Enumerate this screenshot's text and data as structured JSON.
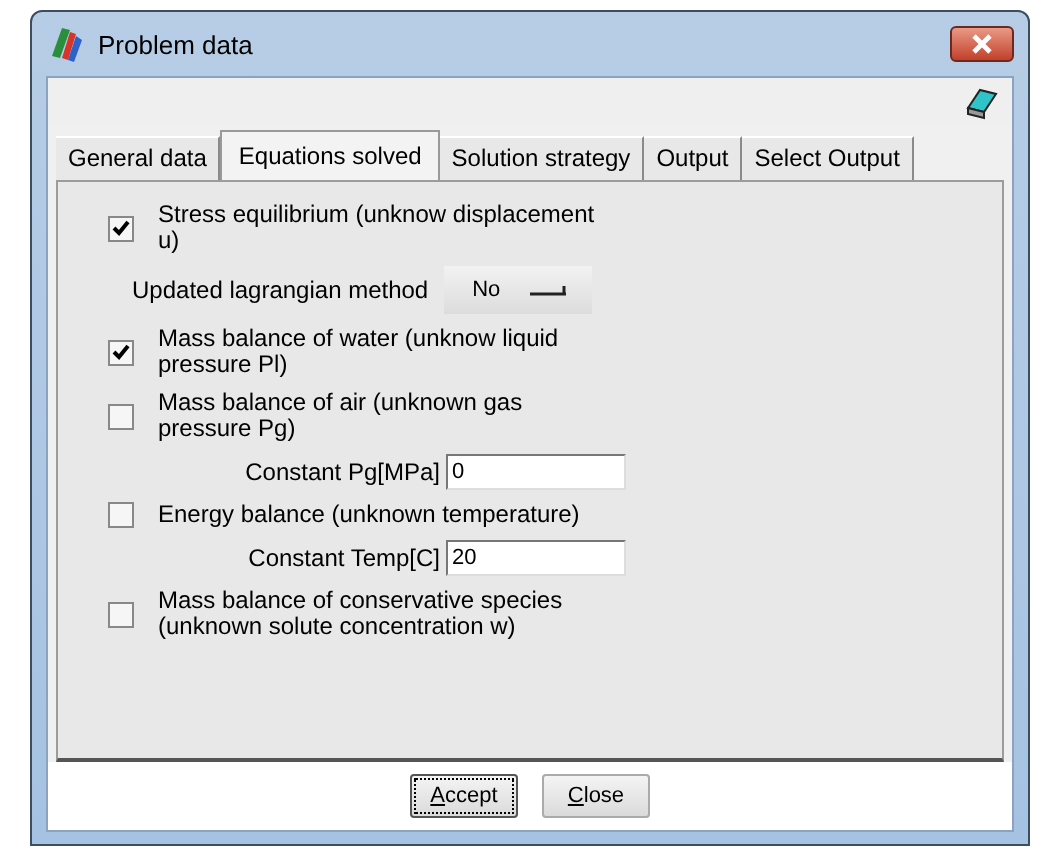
{
  "window": {
    "title": "Problem data"
  },
  "tabs": [
    {
      "label": "General data",
      "selected": false
    },
    {
      "label": "Equations solved",
      "selected": true
    },
    {
      "label": "Solution strategy",
      "selected": false
    },
    {
      "label": "Output",
      "selected": false
    },
    {
      "label": "Select Output",
      "selected": false
    }
  ],
  "rows": [
    {
      "kind": "checkbox",
      "label": "Stress equilibrium (unknow displacement u)",
      "checked": true
    },
    {
      "kind": "dropdown",
      "label": "Updated lagrangian method",
      "value": "No"
    },
    {
      "kind": "checkbox",
      "label": "Mass balance of water (unknow liquid pressure Pl)",
      "checked": true
    },
    {
      "kind": "checkbox",
      "label": "Mass balance of air (unknown  gas pressure Pg)",
      "checked": false
    },
    {
      "kind": "field",
      "label": "Constant Pg[MPa]",
      "value": "0"
    },
    {
      "kind": "checkbox",
      "label": "Energy balance (unknown temperature)",
      "checked": false
    },
    {
      "kind": "field",
      "label": "Constant Temp[C]",
      "value": "20"
    },
    {
      "kind": "checkbox",
      "label": "Mass balance of conservative species (unknown solute concentration w)",
      "checked": false
    }
  ],
  "buttons": [
    {
      "label": "Accept",
      "focused": true
    },
    {
      "label": "Close",
      "focused": false
    }
  ]
}
